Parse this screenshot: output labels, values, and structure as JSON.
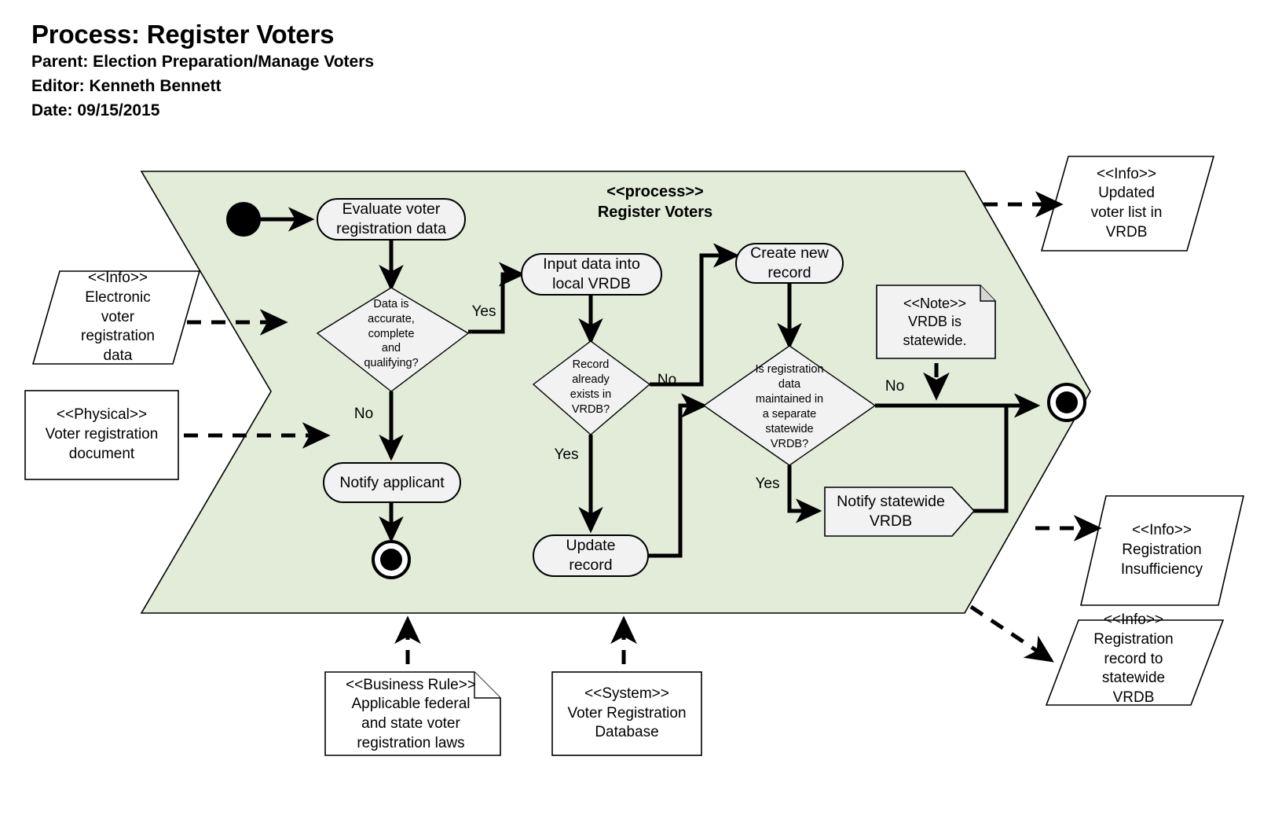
{
  "header": {
    "title": "Process: Register Voters",
    "parent": "Parent: Election Preparation/Manage Voters",
    "editor": "Editor: Kenneth Bennett",
    "date": "Date: 09/15/2015"
  },
  "process": {
    "stereotype": "<<process>>",
    "name": "Register Voters",
    "fill_color": "#e2ecd8",
    "border_color": "#000000"
  },
  "colors": {
    "node_fill": "#f2f2f2",
    "node_border": "#000000",
    "artifact_fill": "#ffffff",
    "note_fill": "#f2f2f2",
    "flow": "#000000"
  },
  "nodes": {
    "start": {
      "name": "initial-node"
    },
    "evaluate": {
      "label": "Evaluate voter\nregistration data"
    },
    "decision_accurate": {
      "label": "Data is\naccurate,\ncomplete\nand\nqualifying?"
    },
    "notify_applicant": {
      "label": "Notify applicant"
    },
    "end_left": {
      "name": "final-node-left"
    },
    "input_data": {
      "label": "Input data into\nlocal VRDB"
    },
    "decision_exists": {
      "label": "Record\nalready\nexists in\nVRDB?"
    },
    "update_record": {
      "label": "Update\nrecord"
    },
    "create_record": {
      "label": "Create  new\nrecord"
    },
    "decision_statewide": {
      "label": "Is registration\ndata\nmaintained in\na separate\nstatewide\nVRDB?"
    },
    "notify_statewide": {
      "label": "Notify statewide\nVRDB"
    },
    "end_right": {
      "name": "final-node-right"
    }
  },
  "edge_labels": {
    "yes_accurate": "Yes",
    "no_accurate": "No",
    "no_exists": "No",
    "yes_exists": "Yes",
    "no_statewide": "No",
    "yes_statewide": "Yes"
  },
  "artifacts": {
    "electronic_data": {
      "stereotype": "<<Info>>",
      "text": "Electronic\nvoter\nregistration\ndata",
      "shape": "parallelogram"
    },
    "physical_document": {
      "stereotype": "<<Physical>>",
      "text": "Voter registration\ndocument",
      "shape": "rectangle"
    },
    "updated_voter_list": {
      "stereotype": "<<Info>>",
      "text": "Updated\nvoter  list in\nVRDB",
      "shape": "parallelogram"
    },
    "registration_insufficiency": {
      "stereotype": "<<Info>>",
      "text": "Registration\nInsufficiency",
      "shape": "parallelogram"
    },
    "registration_record": {
      "stereotype": "<<Info>>",
      "text": "Registration\nrecord to\nstatewide\nVRDB",
      "shape": "parallelogram"
    },
    "note_vrdb": {
      "stereotype": "<<Note>>",
      "text": "VRDB is\nstatewide.",
      "shape": "note"
    },
    "business_rule": {
      "stereotype": "<<Business  Rule>>",
      "text": "Applicable federal\nand state voter\nregistration laws",
      "shape": "note"
    },
    "system": {
      "stereotype": "<<System>>",
      "text": "Voter Registration\nDatabase",
      "shape": "rectangle"
    }
  }
}
